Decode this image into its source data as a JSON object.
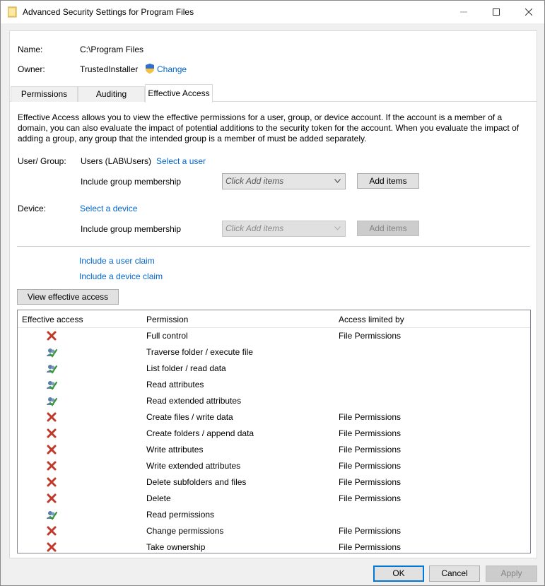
{
  "window": {
    "title": "Advanced Security Settings for Program Files"
  },
  "info": {
    "name_label": "Name:",
    "name_value": "C:\\Program Files",
    "owner_label": "Owner:",
    "owner_value": "TrustedInstaller",
    "change_link": "Change"
  },
  "tabs": [
    {
      "label": "Permissions",
      "active": false
    },
    {
      "label": "Auditing",
      "active": false
    },
    {
      "label": "Effective Access",
      "active": true
    }
  ],
  "description": "Effective Access allows you to view the effective permissions for a user, group, or device account. If the account is a member of a domain, you can also evaluate the impact of potential additions to the security token for the account. When you evaluate the impact of adding a group, any group that the intended group is a member of must be added separately.",
  "user_group": {
    "label": "User/ Group:",
    "value": "Users (LAB\\Users)",
    "select_link": "Select a user",
    "include_label": "Include group membership",
    "dropdown_placeholder": "Click Add items",
    "add_button": "Add items"
  },
  "device": {
    "label": "Device:",
    "select_link": "Select a device",
    "include_label": "Include group membership",
    "dropdown_placeholder": "Click Add items",
    "add_button": "Add items"
  },
  "claims": {
    "user_claim": "Include a user claim",
    "device_claim": "Include a device claim"
  },
  "view_button": "View effective access",
  "table": {
    "headers": [
      "Effective access",
      "Permission",
      "Access limited by"
    ],
    "rows": [
      {
        "status": "denied",
        "permission": "Full control",
        "limited_by": "File Permissions"
      },
      {
        "status": "allowed",
        "permission": "Traverse folder / execute file",
        "limited_by": ""
      },
      {
        "status": "allowed",
        "permission": "List folder / read data",
        "limited_by": ""
      },
      {
        "status": "allowed",
        "permission": "Read attributes",
        "limited_by": ""
      },
      {
        "status": "allowed",
        "permission": "Read extended attributes",
        "limited_by": ""
      },
      {
        "status": "denied",
        "permission": "Create files / write data",
        "limited_by": "File Permissions"
      },
      {
        "status": "denied",
        "permission": "Create folders / append data",
        "limited_by": "File Permissions"
      },
      {
        "status": "denied",
        "permission": "Write attributes",
        "limited_by": "File Permissions"
      },
      {
        "status": "denied",
        "permission": "Write extended attributes",
        "limited_by": "File Permissions"
      },
      {
        "status": "denied",
        "permission": "Delete subfolders and files",
        "limited_by": "File Permissions"
      },
      {
        "status": "denied",
        "permission": "Delete",
        "limited_by": "File Permissions"
      },
      {
        "status": "allowed",
        "permission": "Read permissions",
        "limited_by": ""
      },
      {
        "status": "denied",
        "permission": "Change permissions",
        "limited_by": "File Permissions"
      },
      {
        "status": "denied",
        "permission": "Take ownership",
        "limited_by": "File Permissions"
      }
    ]
  },
  "footer": {
    "ok": "OK",
    "cancel": "Cancel",
    "apply": "Apply"
  },
  "colors": {
    "link": "#0066cc",
    "deny": "#c0392b",
    "allow": "#3a9a3a",
    "accent": "#0078d7"
  }
}
